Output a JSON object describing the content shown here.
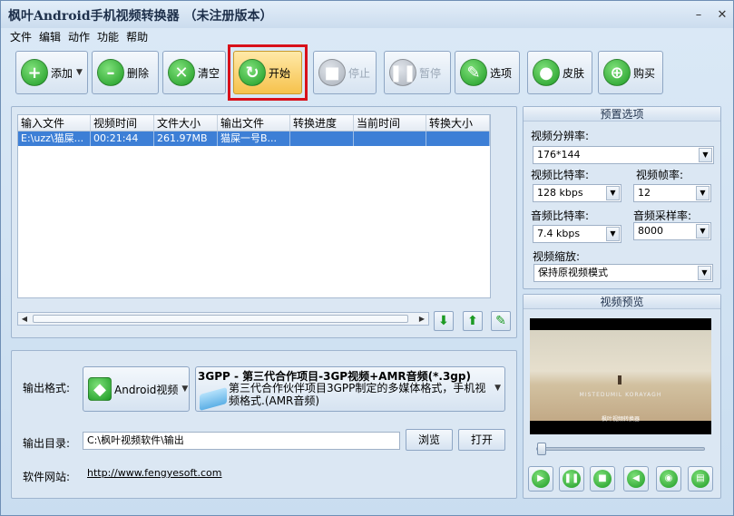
{
  "window": {
    "title": "枫叶Android手机视频转换器 （未注册版本）",
    "min_glyph": "–",
    "close_glyph": "✕"
  },
  "menu": [
    "文件",
    "编辑",
    "动作",
    "功能",
    "帮助"
  ],
  "toolbar": {
    "add": "添加",
    "delete": "删除",
    "clear": "清空",
    "start": "开始",
    "stop": "停止",
    "pause": "暂停",
    "options": "选项",
    "skin": "皮肤",
    "buy": "购买"
  },
  "file_table": {
    "columns": [
      "输入文件",
      "视频时间",
      "文件大小",
      "输出文件",
      "转换进度",
      "当前时间",
      "转换大小"
    ],
    "rows": [
      [
        "E:\\uzz\\猫屎...",
        "00:21:44",
        "261.97MB",
        "猫屎一号B...",
        "",
        "",
        ""
      ]
    ]
  },
  "presets": {
    "title": "预置选项",
    "resolution_label": "视频分辨率:",
    "resolution_value": "176*144",
    "video_bitrate_label": "视频比特率:",
    "video_bitrate_value": "128 kbps",
    "framerate_label": "视频帧率:",
    "framerate_value": "12",
    "audio_bitrate_label": "音频比特率:",
    "audio_bitrate_value": "7.4 kbps",
    "samplerate_label": "音频采样率:",
    "samplerate_value": "8000",
    "scale_label": "视频缩放:",
    "scale_value": "保持原视频模式"
  },
  "preview": {
    "title": "视频预览",
    "caption_line1": "MISTEDUMIL KORAYAGH",
    "caption_line2": "枫叶视频转换器",
    "progress": 0.0
  },
  "output": {
    "format_label": "输出格式:",
    "device_value": "Android视频",
    "format_title": "3GPP - 第三代合作项目-3GP视频+AMR音频(*.3gp)",
    "format_desc": "第三代合作伙伴项目3GPP制定的多媒体格式，手机视频格式.(AMR音频)",
    "dir_label": "输出目录:",
    "dir_value": "C:\\枫叶视频软件\\输出",
    "browse": "浏览",
    "open": "打开",
    "site_label": "软件网站:",
    "site_url": "http://www.fengyesoft.com"
  },
  "colors": {
    "highlight": "#d8101a",
    "selected_row": "#3d7fd6",
    "accent_green": "#1c9a23"
  }
}
